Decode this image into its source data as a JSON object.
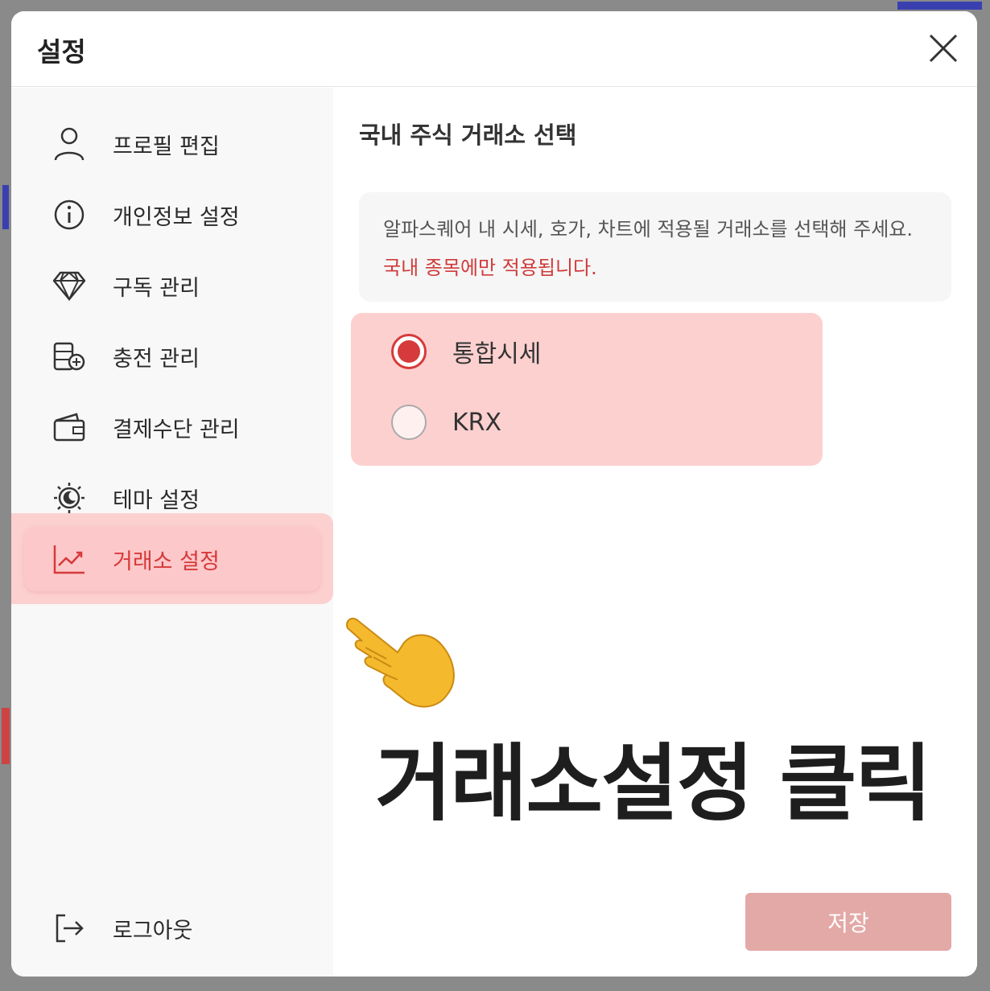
{
  "dialog": {
    "title": "설정",
    "close_icon": "close-icon"
  },
  "sidebar": {
    "items": [
      {
        "label": "프로필 편집",
        "icon": "user-icon"
      },
      {
        "label": "개인정보 설정",
        "icon": "info-icon"
      },
      {
        "label": "구독 관리",
        "icon": "diamond-icon"
      },
      {
        "label": "충전 관리",
        "icon": "coin-stack-icon"
      },
      {
        "label": "결제수단 관리",
        "icon": "wallet-icon"
      },
      {
        "label": "테마 설정",
        "icon": "theme-sun-moon-icon"
      },
      {
        "label": "거래소 설정",
        "icon": "chart-line-icon",
        "active": true
      }
    ],
    "logout": {
      "label": "로그아웃",
      "icon": "logout-icon"
    }
  },
  "main": {
    "section_title": "국내 주식 거래소 선택",
    "info_text": "알파스퀘어 내 시세, 호가, 차트에 적용될 거래소를 선택해 주세요.",
    "info_highlight": "국내 종목에만 적용됩니다.",
    "options": [
      {
        "label": "통합시세",
        "checked": true
      },
      {
        "label": "KRX",
        "checked": false
      }
    ],
    "save_label": "저장"
  },
  "annotation": {
    "text": "거래소설정 클릭",
    "pointer_icon": "pointing-hand-icon"
  },
  "colors": {
    "accent": "#d63a3a",
    "highlight": "#fdd0d0",
    "save_button": "#e3a9a7"
  }
}
